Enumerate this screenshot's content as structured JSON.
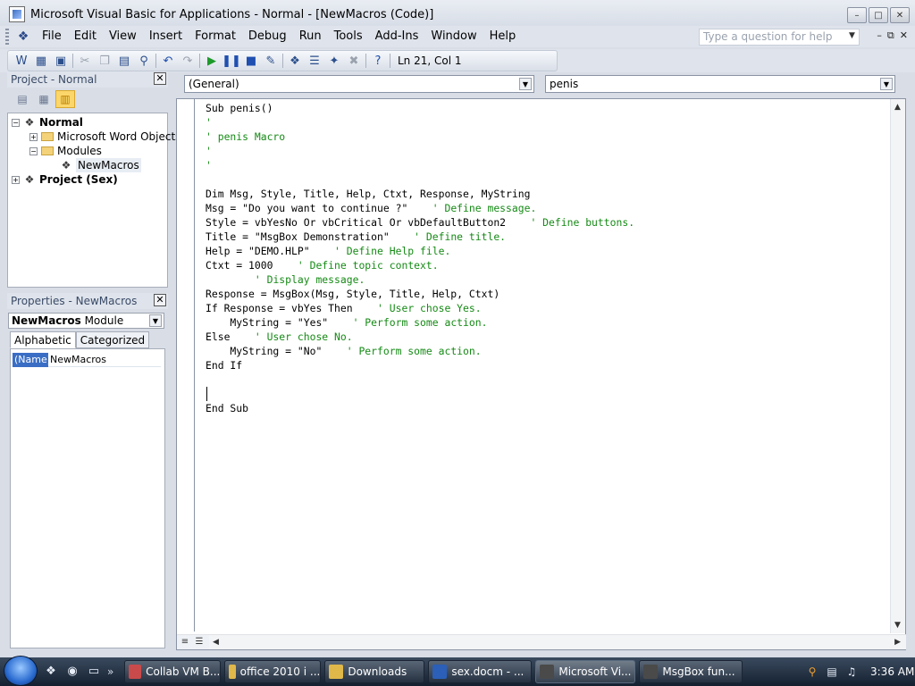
{
  "window": {
    "title": "Microsoft Visual Basic for Applications - Normal - [NewMacros (Code)]"
  },
  "menu": {
    "items": [
      "File",
      "Edit",
      "View",
      "Insert",
      "Format",
      "Debug",
      "Run",
      "Tools",
      "Add-Ins",
      "Window",
      "Help"
    ],
    "help_placeholder": "Type a question for help"
  },
  "toolbar": {
    "cursor_position": "Ln 21, Col 1"
  },
  "project": {
    "title": "Project - Normal",
    "tree": {
      "root": "Normal",
      "word_objects": "Microsoft Word Objects",
      "modules": "Modules",
      "new_macros": "NewMacros",
      "second_project": "Project (Sex)"
    }
  },
  "properties": {
    "title": "Properties - NewMacros",
    "object_name": "NewMacros",
    "object_type": "Module",
    "tabs": [
      "Alphabetic",
      "Categorized"
    ],
    "rows": [
      {
        "key": "(Name)",
        "value": "NewMacros"
      }
    ]
  },
  "code": {
    "object_combo": "(General)",
    "proc_combo": "penis",
    "lines": [
      {
        "code": "Sub penis()",
        "comment": ""
      },
      {
        "code": "",
        "comment": "'"
      },
      {
        "code": "",
        "comment": "' penis Macro"
      },
      {
        "code": "",
        "comment": "'"
      },
      {
        "code": "",
        "comment": "'"
      },
      {
        "code": "",
        "comment": ""
      },
      {
        "code": "Dim Msg, Style, Title, Help, Ctxt, Response, MyString",
        "comment": ""
      },
      {
        "code": "Msg = \"Do you want to continue ?\"    ",
        "comment": "' Define message."
      },
      {
        "code": "Style = vbYesNo Or vbCritical Or vbDefaultButton2    ",
        "comment": "' Define buttons."
      },
      {
        "code": "Title = \"MsgBox Demonstration\"    ",
        "comment": "' Define title."
      },
      {
        "code": "Help = \"DEMO.HLP\"    ",
        "comment": "' Define Help file."
      },
      {
        "code": "Ctxt = 1000    ",
        "comment": "' Define topic context."
      },
      {
        "code": "        ",
        "comment": "' Display message."
      },
      {
        "code": "Response = MsgBox(Msg, Style, Title, Help, Ctxt)",
        "comment": ""
      },
      {
        "code": "If Response = vbYes Then    ",
        "comment": "' User chose Yes."
      },
      {
        "code": "    MyString = \"Yes\"    ",
        "comment": "' Perform some action."
      },
      {
        "code": "Else    ",
        "comment": "' User chose No."
      },
      {
        "code": "    MyString = \"No\"    ",
        "comment": "' Perform some action."
      },
      {
        "code": "End If",
        "comment": ""
      },
      {
        "code": "",
        "comment": ""
      },
      {
        "code": "",
        "comment": ""
      },
      {
        "code": "End Sub",
        "comment": ""
      }
    ]
  },
  "taskbar": {
    "buttons": [
      {
        "label": "Collab VM B...",
        "icon_color": "#c94a4a"
      },
      {
        "label": "office 2010 i ...",
        "icon_color": "#e0b84a"
      },
      {
        "label": "Downloads",
        "icon_color": "#e0b84a"
      },
      {
        "label": "sex.docm - ...",
        "icon_color": "#2b5fb8"
      },
      {
        "label": "Microsoft Vi...",
        "icon_color": "#4a4a4a"
      },
      {
        "label": "MsgBox fun...",
        "icon_color": "#4a4a4a"
      }
    ],
    "clock": "3:36 AM"
  }
}
